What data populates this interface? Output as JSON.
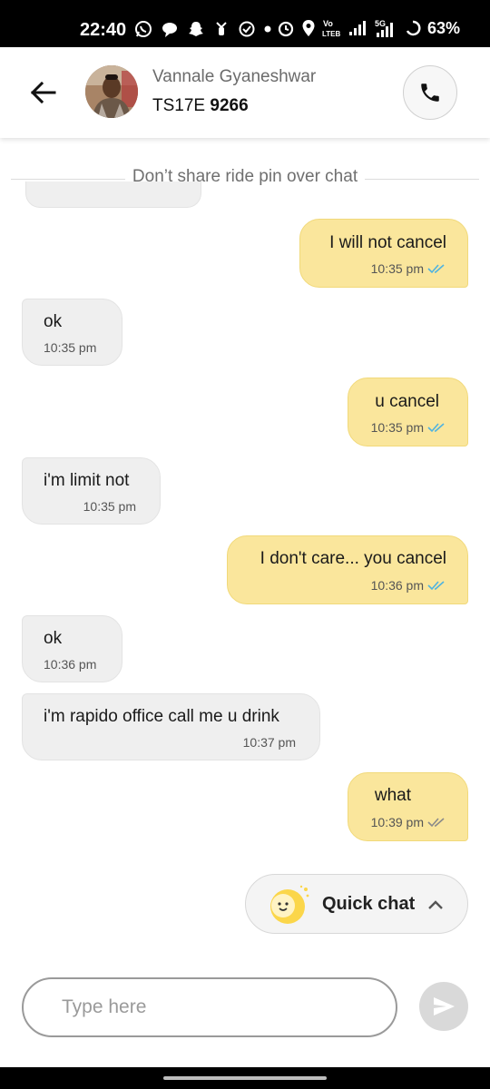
{
  "status_bar": {
    "time": "22:40",
    "network_label_top": "Vo",
    "network_label_bottom": "LTEB",
    "network_gen": "5G",
    "battery": "63%"
  },
  "header": {
    "driver_name": "Vannale Gyaneshwar",
    "plate_prefix": "TS17E",
    "plate_number": "9266"
  },
  "notice": "Don’t share ride pin over chat",
  "messages": [
    {
      "direction": "outgoing",
      "text": "I will not cancel",
      "time": "10:35 pm",
      "status": "delivered"
    },
    {
      "direction": "incoming",
      "text": "ok",
      "time": "10:35 pm"
    },
    {
      "direction": "outgoing",
      "text": "u cancel",
      "time": "10:35 pm",
      "status": "delivered"
    },
    {
      "direction": "incoming",
      "text": "i'm limit not",
      "time": "10:35 pm"
    },
    {
      "direction": "outgoing",
      "text": "I don't care... you cancel",
      "time": "10:36 pm",
      "status": "delivered"
    },
    {
      "direction": "incoming",
      "text": "ok",
      "time": "10:36 pm"
    },
    {
      "direction": "incoming",
      "text": "i'm rapido office call me u drink",
      "time": "10:37 pm"
    },
    {
      "direction": "outgoing",
      "text": "what",
      "time": "10:39 pm",
      "status": "sent"
    }
  ],
  "quick_chat": {
    "label": "Quick chat"
  },
  "composer": {
    "placeholder": "Type here",
    "value": ""
  },
  "colors": {
    "outgoing_bubble": "#fae69c",
    "incoming_bubble": "#efefef",
    "tick_read": "#4fb3e0",
    "tick_sent": "#8a8a8a"
  }
}
